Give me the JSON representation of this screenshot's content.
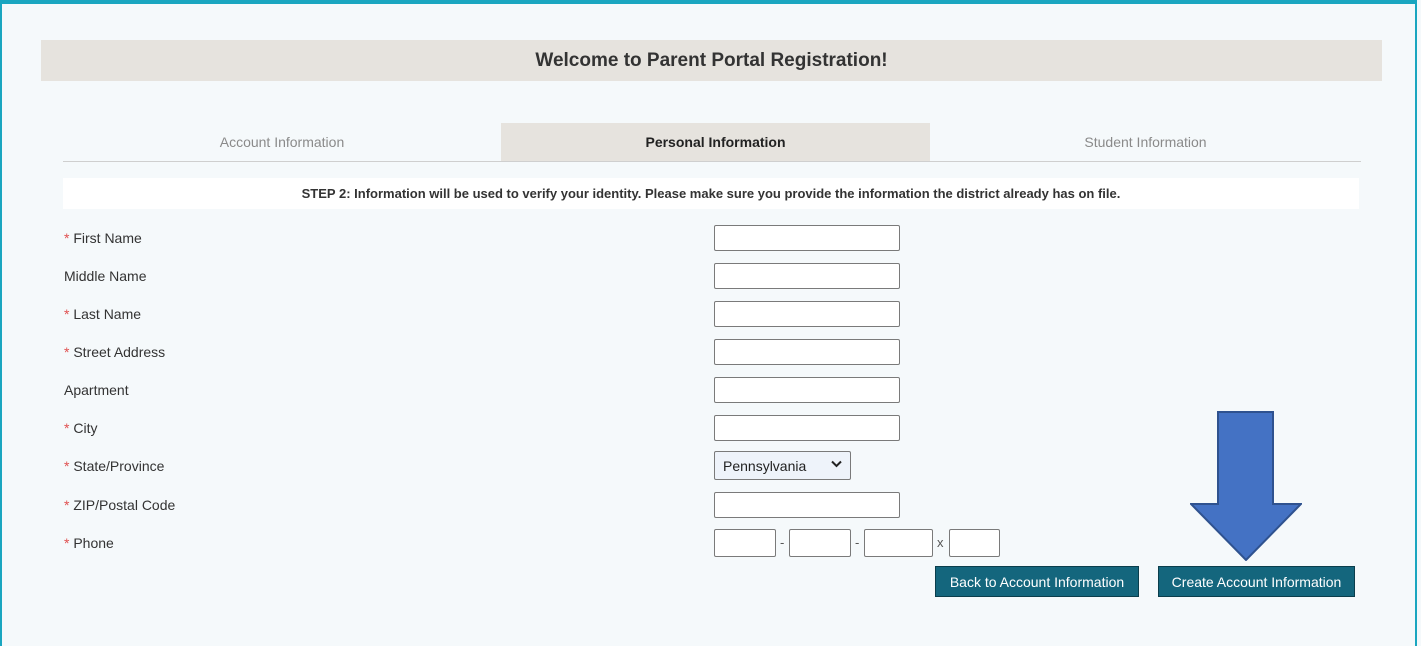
{
  "header": {
    "title": "Welcome to Parent Portal Registration!"
  },
  "tabs": [
    {
      "label": "Account Information",
      "active": false
    },
    {
      "label": "Personal Information",
      "active": true
    },
    {
      "label": "Student Information",
      "active": false
    }
  ],
  "step_message": "STEP 2: Information will be used to verify your identity. Please make sure you provide the information the district already has on file.",
  "form": {
    "required_marker": "*",
    "fields": [
      {
        "label": "First Name",
        "required": true,
        "value": ""
      },
      {
        "label": "Middle Name",
        "required": false,
        "value": ""
      },
      {
        "label": "Last Name",
        "required": true,
        "value": ""
      },
      {
        "label": "Street Address",
        "required": true,
        "value": ""
      },
      {
        "label": "Apartment",
        "required": false,
        "value": ""
      },
      {
        "label": "City",
        "required": true,
        "value": ""
      }
    ],
    "state": {
      "label": "State/Province",
      "required": true,
      "selected": "Pennsylvania"
    },
    "zip": {
      "label": "ZIP/Postal Code",
      "required": true,
      "value": ""
    },
    "phone": {
      "label": "Phone",
      "required": true,
      "separator": "-",
      "ext_separator": "x"
    }
  },
  "buttons": {
    "back": "Back to Account Information",
    "create": "Create Account Information"
  },
  "colors": {
    "frame_border": "#1aa6c0",
    "button_bg": "#14667d",
    "arrow_fill": "#4472c4",
    "arrow_stroke": "#2f528f",
    "required": "#e05050"
  }
}
